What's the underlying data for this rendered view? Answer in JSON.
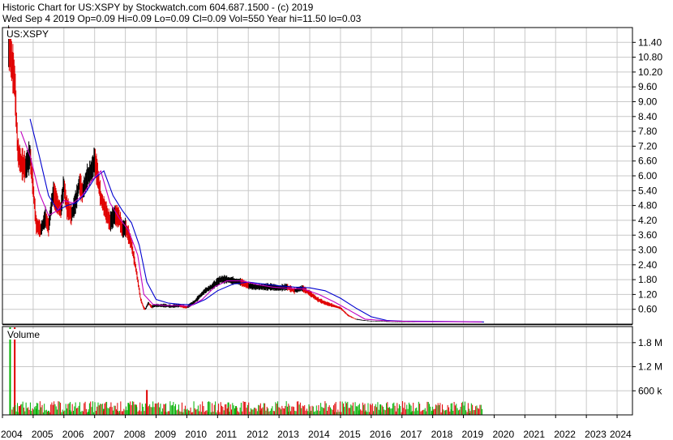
{
  "header": {
    "title": "Historic Chart for US:XSPY by Stockwatch.com 604.687.1500 - (c) 2019",
    "quote": "Wed Sep  4 2019   Op=0.09  Hi=0.09  Lo=0.09  Cl=0.09  Vol=550  Year hi=11.50  lo=0.03"
  },
  "colors": {
    "background": "#ffffff",
    "grid": "#c8c8c8",
    "axis": "#000000",
    "price_bar": "#000000",
    "price_down": "#e00000",
    "ma_short": "#c000c0",
    "ma_long": "#0000d0",
    "volume_up": "#00b000",
    "volume_down": "#e00000",
    "volume_flat": "#909090"
  },
  "chart_data": [
    {
      "type": "line",
      "symbol_label": "US:XSPY",
      "ylim": [
        0,
        12
      ],
      "y_ticks": [
        0.6,
        1.2,
        1.8,
        2.4,
        3.0,
        3.6,
        4.2,
        4.8,
        5.4,
        6.0,
        6.6,
        7.2,
        7.8,
        8.4,
        9.0,
        9.6,
        10.2,
        10.8,
        11.4
      ],
      "y_tick_labels": [
        "0.60",
        "1.20",
        "1.80",
        "2.40",
        "3.00",
        "3.60",
        "4.20",
        "4.80",
        "5.40",
        "6.00",
        "6.60",
        "7.20",
        "7.80",
        "8.40",
        "9.00",
        "9.60",
        "10.20",
        "10.80",
        "11.40"
      ],
      "xlim": [
        2004.0,
        2024.5
      ],
      "x_ticks": [
        2004,
        2005,
        2006,
        2007,
        2008,
        2009,
        2010,
        2011,
        2012,
        2013,
        2014,
        2015,
        2016,
        2017,
        2018,
        2019,
        2020,
        2021,
        2022,
        2023,
        2024
      ],
      "x_tick_labels": [
        "2004",
        "2005",
        "2006",
        "2007",
        "2008",
        "2009",
        "2010",
        "2011",
        "2012",
        "2013",
        "2014",
        "2015",
        "2016",
        "2017",
        "2018",
        "2019",
        "2020",
        "2021",
        "2022",
        "2023",
        "2024"
      ],
      "grid": true,
      "series": [
        {
          "role": "price",
          "x": [
            2004.2,
            2004.3,
            2004.4,
            2004.5,
            2004.6,
            2004.75,
            2004.9,
            2005.0,
            2005.1,
            2005.25,
            2005.4,
            2005.5,
            2005.65,
            2005.8,
            2005.9,
            2006.0,
            2006.1,
            2006.25,
            2006.4,
            2006.5,
            2006.6,
            2006.75,
            2006.9,
            2007.0,
            2007.1,
            2007.2,
            2007.35,
            2007.5,
            2007.65,
            2007.8,
            2007.9,
            2008.0,
            2008.1,
            2008.2,
            2008.35,
            2008.5,
            2008.6,
            2008.65,
            2008.75,
            2008.85,
            2009.0,
            2009.25,
            2009.5,
            2009.75,
            2010.0,
            2010.25,
            2010.4,
            2010.6,
            2010.8,
            2011.0,
            2011.1,
            2011.3,
            2011.5,
            2011.75,
            2012.0,
            2012.25,
            2012.5,
            2012.75,
            2013.0,
            2013.25,
            2013.5,
            2013.75,
            2014.0,
            2014.25,
            2014.5,
            2014.75,
            2015.0,
            2015.25,
            2015.5,
            2015.75,
            2016.0,
            2016.25,
            2016.5,
            2016.75,
            2017.0,
            2017.5,
            2018.0,
            2018.5,
            2019.0,
            2019.5,
            2019.67
          ],
          "y": [
            11.2,
            10.6,
            9.8,
            7.0,
            6.5,
            6.3,
            6.8,
            5.5,
            4.0,
            3.8,
            4.3,
            3.9,
            5.3,
            4.8,
            4.6,
            5.6,
            4.7,
            4.4,
            5.0,
            5.7,
            5.3,
            5.9,
            6.2,
            6.6,
            6.0,
            5.1,
            4.6,
            4.1,
            4.4,
            4.3,
            3.8,
            3.9,
            3.6,
            3.2,
            2.2,
            1.0,
            0.65,
            0.6,
            0.85,
            0.7,
            0.75,
            0.75,
            0.72,
            0.75,
            0.68,
            0.9,
            1.1,
            1.35,
            1.5,
            1.7,
            1.8,
            1.8,
            1.75,
            1.7,
            1.55,
            1.5,
            1.5,
            1.5,
            1.45,
            1.5,
            1.35,
            1.45,
            1.25,
            1.0,
            0.85,
            0.75,
            0.65,
            0.35,
            0.2,
            0.15,
            0.12,
            0.12,
            0.1,
            0.09,
            0.09,
            0.09,
            0.1,
            0.1,
            0.1,
            0.09,
            0.09
          ]
        },
        {
          "role": "ma_short",
          "x": [
            2004.6,
            2004.9,
            2005.2,
            2005.5,
            2005.8,
            2006.0,
            2006.3,
            2006.6,
            2006.9,
            2007.2,
            2007.5,
            2007.8,
            2008.1,
            2008.4,
            2008.6,
            2008.9,
            2009.3,
            2009.7,
            2010.1,
            2010.5,
            2010.9,
            2011.3,
            2011.8,
            2012.3,
            2012.8,
            2013.3,
            2013.8,
            2014.3,
            2014.8,
            2015.3,
            2015.8,
            2016.5,
            2017.5,
            2018.5,
            2019.6
          ],
          "y": [
            7.8,
            6.8,
            5.3,
            4.4,
            4.6,
            5.0,
            4.9,
            5.2,
            5.8,
            6.2,
            4.9,
            4.3,
            3.8,
            2.8,
            1.2,
            0.8,
            0.75,
            0.75,
            0.72,
            1.0,
            1.5,
            1.75,
            1.75,
            1.6,
            1.5,
            1.45,
            1.42,
            1.2,
            0.9,
            0.55,
            0.2,
            0.13,
            0.1,
            0.1,
            0.09
          ]
        },
        {
          "role": "ma_long",
          "x": [
            2004.9,
            2005.2,
            2005.5,
            2005.8,
            2006.1,
            2006.4,
            2006.7,
            2007.0,
            2007.3,
            2007.6,
            2007.9,
            2008.2,
            2008.45,
            2008.7,
            2009.0,
            2009.4,
            2009.8,
            2010.2,
            2010.6,
            2011.0,
            2011.5,
            2012.0,
            2012.5,
            2013.0,
            2013.5,
            2014.0,
            2014.5,
            2015.0,
            2015.5,
            2016.0,
            2016.5,
            2017.0,
            2018.0,
            2019.0,
            2019.67
          ],
          "y": [
            8.3,
            6.8,
            5.2,
            4.6,
            4.8,
            4.9,
            5.3,
            5.9,
            6.2,
            5.2,
            4.6,
            4.1,
            3.2,
            1.7,
            1.0,
            0.85,
            0.8,
            0.78,
            1.0,
            1.35,
            1.62,
            1.7,
            1.62,
            1.55,
            1.5,
            1.47,
            1.35,
            1.05,
            0.65,
            0.3,
            0.15,
            0.12,
            0.11,
            0.1,
            0.09
          ]
        }
      ]
    },
    {
      "type": "bar",
      "title": "Volume",
      "ylim": [
        0,
        2200000
      ],
      "y_ticks": [
        600000,
        1200000,
        1800000
      ],
      "y_tick_labels": [
        "600 k",
        "1.2 M",
        "1.8 M"
      ],
      "xlim": [
        2004.0,
        2024.5
      ],
      "grid": true,
      "x": [
        2004.25,
        2004.4,
        2004.55,
        2005.1,
        2005.5,
        2006.2,
        2006.8,
        2007.3,
        2007.75,
        2008.1,
        2008.35,
        2008.7,
        2009.3,
        2010.0,
        2010.7,
        2011.35,
        2011.6,
        2012.4,
        2013.3,
        2014.0,
        2014.8,
        2015.6,
        2015.8,
        2016.3,
        2016.55,
        2017.3,
        2018.0,
        2018.6,
        2019.2
      ],
      "values": [
        2200000,
        2200000,
        220000,
        150000,
        100000,
        120000,
        80000,
        150000,
        100000,
        300000,
        250000,
        620000,
        80000,
        60000,
        70000,
        310000,
        220000,
        110000,
        80000,
        60000,
        70000,
        110000,
        80000,
        260000,
        180000,
        70000,
        110000,
        140000,
        40000
      ],
      "directions": [
        "up",
        "down",
        "down",
        "up",
        "up",
        "up",
        "up",
        "up",
        "up",
        "up",
        "down",
        "down",
        "down",
        "up",
        "up",
        "up",
        "up",
        "up",
        "up",
        "up",
        "up",
        "up",
        "down",
        "up",
        "up",
        "up",
        "up",
        "flat",
        "up"
      ]
    }
  ]
}
